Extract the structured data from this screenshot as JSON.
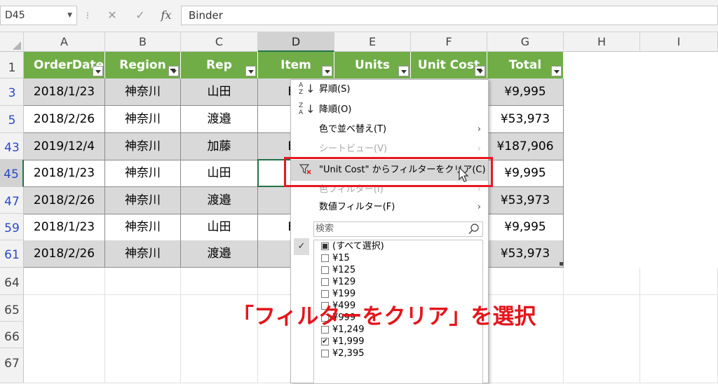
{
  "formula_bar": {
    "name_box": "D45",
    "separator": "⁝",
    "cancel_icon": "✕",
    "enter_icon": "✓",
    "fx_label": "fx",
    "content": "Binder"
  },
  "columns": [
    "A",
    "B",
    "C",
    "D",
    "E",
    "F",
    "G",
    "H",
    "I"
  ],
  "header_row_num": "1",
  "table_headers": [
    "OrderDate",
    "Region",
    "Rep",
    "Item",
    "Units",
    "Unit Cost",
    "Total"
  ],
  "rows": [
    {
      "num": "3",
      "date": "2018/1/23",
      "region": "神奈川",
      "rep": "山田",
      "item": "Bir",
      "total": "¥9,995"
    },
    {
      "num": "5",
      "date": "2018/2/26",
      "region": "神奈川",
      "rep": "渡邉",
      "item": "P",
      "total": "¥53,973"
    },
    {
      "num": "43",
      "date": "2019/12/4",
      "region": "神奈川",
      "rep": "加藤",
      "item": "Bir",
      "total": "¥187,906"
    },
    {
      "num": "45",
      "date": "2018/1/23",
      "region": "神奈川",
      "rep": "山田",
      "item": "Bi",
      "total": "¥9,995"
    },
    {
      "num": "47",
      "date": "2018/2/26",
      "region": "神奈川",
      "rep": "渡邉",
      "item": "P",
      "total": "¥53,973"
    },
    {
      "num": "59",
      "date": "2018/1/23",
      "region": "神奈川",
      "rep": "山田",
      "item": "Bir",
      "total": "¥9,995"
    },
    {
      "num": "61",
      "date": "2018/2/26",
      "region": "神奈川",
      "rep": "渡邉",
      "item": "P",
      "total": "¥53,973"
    }
  ],
  "blank_rows": [
    "64",
    "65",
    "66",
    "67"
  ],
  "menu": {
    "sort_asc": "昇順(S)",
    "sort_desc": "降順(O)",
    "sort_by_color": "色で並べ替え(T)",
    "sheet_view": "シートビュー(V)",
    "clear_filter": "\"Unit Cost\" からフィルターをクリア(C)",
    "color_filter": "色フィルター(I)",
    "number_filter": "数値フィルター(F)",
    "search_placeholder": "検索",
    "check_mark": "✓",
    "submenu_arrow": "›",
    "values": [
      {
        "label": "(すべて選択)",
        "state": "partial"
      },
      {
        "label": "¥15",
        "state": "off"
      },
      {
        "label": "¥125",
        "state": "off"
      },
      {
        "label": "¥129",
        "state": "off"
      },
      {
        "label": "¥199",
        "state": "off"
      },
      {
        "label": "¥499",
        "state": "off"
      },
      {
        "label": "¥999",
        "state": "off"
      },
      {
        "label": "¥1,249",
        "state": "off"
      },
      {
        "label": "¥1,999",
        "state": "on"
      },
      {
        "label": "¥2,395",
        "state": "off"
      }
    ]
  },
  "caption": "「フィルターをクリア」を選択",
  "colors": {
    "header_green": "#70ad47",
    "stripe_gray": "#d9d9d9",
    "highlight_red": "#e8181f",
    "caption_red": "#e4151b"
  }
}
